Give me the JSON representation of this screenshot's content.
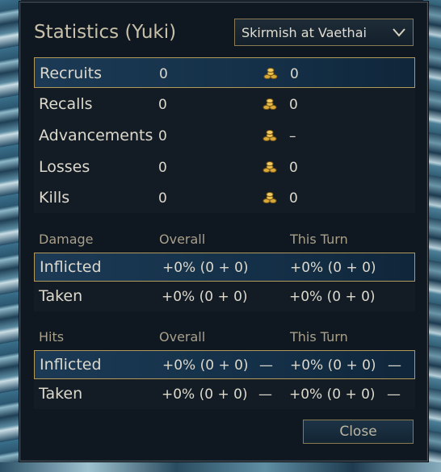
{
  "dialog": {
    "title": "Statistics (Yuki)",
    "scenario_select": {
      "selected": "Skirmish at Vaethai"
    },
    "close_label": "Close"
  },
  "units": {
    "rows": [
      {
        "label": "Recruits",
        "count": "0",
        "gold": "0"
      },
      {
        "label": "Recalls",
        "count": "0",
        "gold": "0"
      },
      {
        "label": "Advancements",
        "count": "0",
        "gold": "–"
      },
      {
        "label": "Losses",
        "count": "0",
        "gold": "0"
      },
      {
        "label": "Kills",
        "count": "0",
        "gold": "0"
      }
    ],
    "gold_icon": "gold-coins-icon"
  },
  "damage": {
    "header": {
      "label": "Damage",
      "overall": "Overall",
      "this_turn": "This Turn"
    },
    "rows": [
      {
        "label": "Inflicted",
        "overall": "+0% (0 + 0)",
        "this_turn": "+0% (0 + 0)"
      },
      {
        "label": "Taken",
        "overall": "+0% (0 + 0)",
        "this_turn": "+0% (0 + 0)"
      }
    ]
  },
  "hits": {
    "header": {
      "label": "Hits",
      "overall": "Overall",
      "this_turn": "This Turn"
    },
    "rows": [
      {
        "label": "Inflicted",
        "overall": "+0% (0 + 0)",
        "overall_extra": "—",
        "this_turn": "+0% (0 + 0)",
        "this_turn_extra": "—"
      },
      {
        "label": "Taken",
        "overall": "+0% (0 + 0)",
        "overall_extra": "—",
        "this_turn": "+0% (0 + 0)",
        "this_turn_extra": "—"
      }
    ]
  },
  "colors": {
    "accent_border": "#b39a5a",
    "text": "#ddd9cc",
    "header_text": "#a9a08a",
    "selected_row": "#1c3a55"
  }
}
